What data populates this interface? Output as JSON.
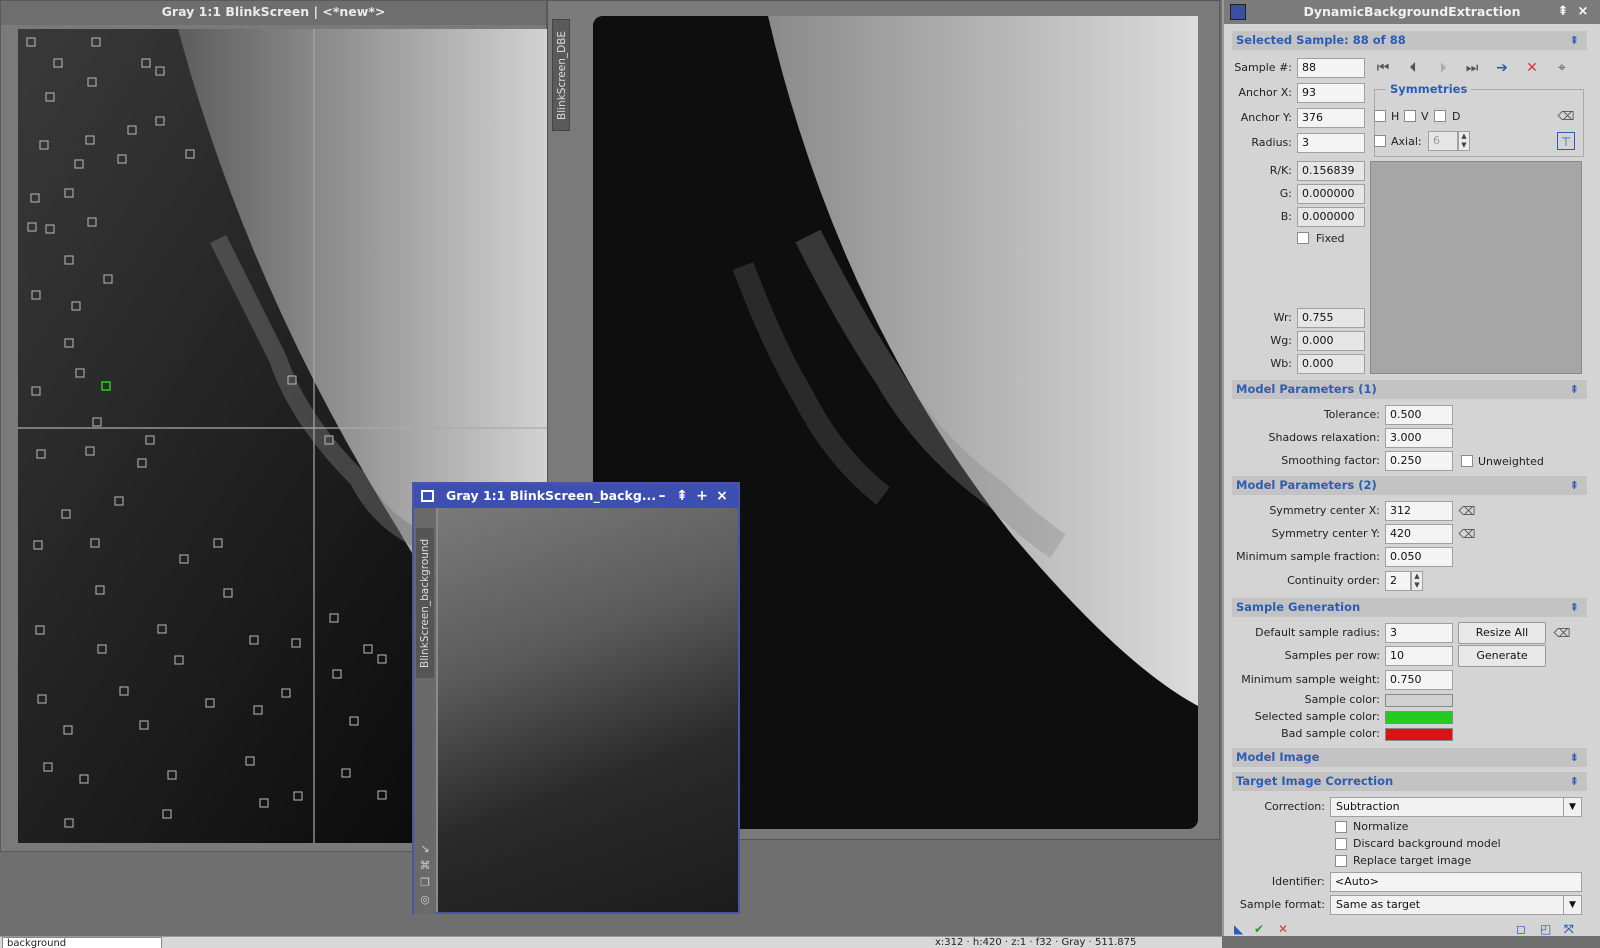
{
  "windows": {
    "left": {
      "title": "Gray 1:1 BlinkScreen | <*new*>"
    },
    "middle": {
      "tab": "BlinkScreen_DBE"
    },
    "background": {
      "title": "Gray 1:1 BlinkScreen_backg...",
      "tab": "BlinkScreen_background"
    }
  },
  "dbe": {
    "title": "DynamicBackgroundExtraction",
    "selected": {
      "header": "Selected Sample: 88 of 88",
      "sample_label": "Sample #:",
      "sample": "88",
      "anchor_x_label": "Anchor X:",
      "anchor_x": "93",
      "anchor_y_label": "Anchor Y:",
      "anchor_y": "376",
      "radius_label": "Radius:",
      "radius": "3",
      "symmetries": "Symmetries",
      "h": "H",
      "v": "V",
      "d": "D",
      "axial": "Axial:",
      "axial_value": "6",
      "rk_label": "R/K:",
      "rk": "0.156839",
      "g_label": "G:",
      "g": "0.000000",
      "b_label": "B:",
      "b": "0.000000",
      "fixed": "Fixed",
      "wr_label": "Wr:",
      "wr": "0.755",
      "wg_label": "Wg:",
      "wg": "0.000",
      "wb_label": "Wb:",
      "wb": "0.000"
    },
    "model1": {
      "header": "Model Parameters (1)",
      "tolerance_label": "Tolerance:",
      "tolerance": "0.500",
      "shadows_label": "Shadows relaxation:",
      "shadows": "3.000",
      "smoothing_label": "Smoothing factor:",
      "smoothing": "0.250",
      "unweighted": "Unweighted"
    },
    "model2": {
      "header": "Model Parameters (2)",
      "symx_label": "Symmetry center X:",
      "symx": "312",
      "symy_label": "Symmetry center Y:",
      "symy": "420",
      "minfrac_label": "Minimum sample fraction:",
      "minfrac": "0.050",
      "cont_label": "Continuity order:",
      "cont": "2"
    },
    "gen": {
      "header": "Sample Generation",
      "radius_label": "Default sample radius:",
      "radius": "3",
      "resize": "Resize All",
      "perrow_label": "Samples per row:",
      "perrow": "10",
      "generate": "Generate",
      "minw_label": "Minimum sample weight:",
      "minw": "0.750",
      "color_label": "Sample color:",
      "sel_color_label": "Selected sample color:",
      "bad_color_label": "Bad sample color:"
    },
    "model_image": {
      "header": "Model Image"
    },
    "correction": {
      "header": "Target Image Correction",
      "corr_label": "Correction:",
      "corr": "Subtraction",
      "normalize": "Normalize",
      "discard": "Discard background model",
      "replace": "Replace target image",
      "ident_label": "Identifier:",
      "ident": "<Auto>",
      "format_label": "Sample format:",
      "format": "Same as target"
    }
  },
  "status": {
    "view": "background",
    "coords": "x:312  ·  h:420  ·  z:1  ·  f32  ·  Gray  ·  511.875"
  },
  "colors": {
    "sample": "#d0d0d0",
    "selected": "#22cc22",
    "bad": "#dd1111",
    "accent": "#2a5db3",
    "window_title": "#3d4fb0"
  }
}
